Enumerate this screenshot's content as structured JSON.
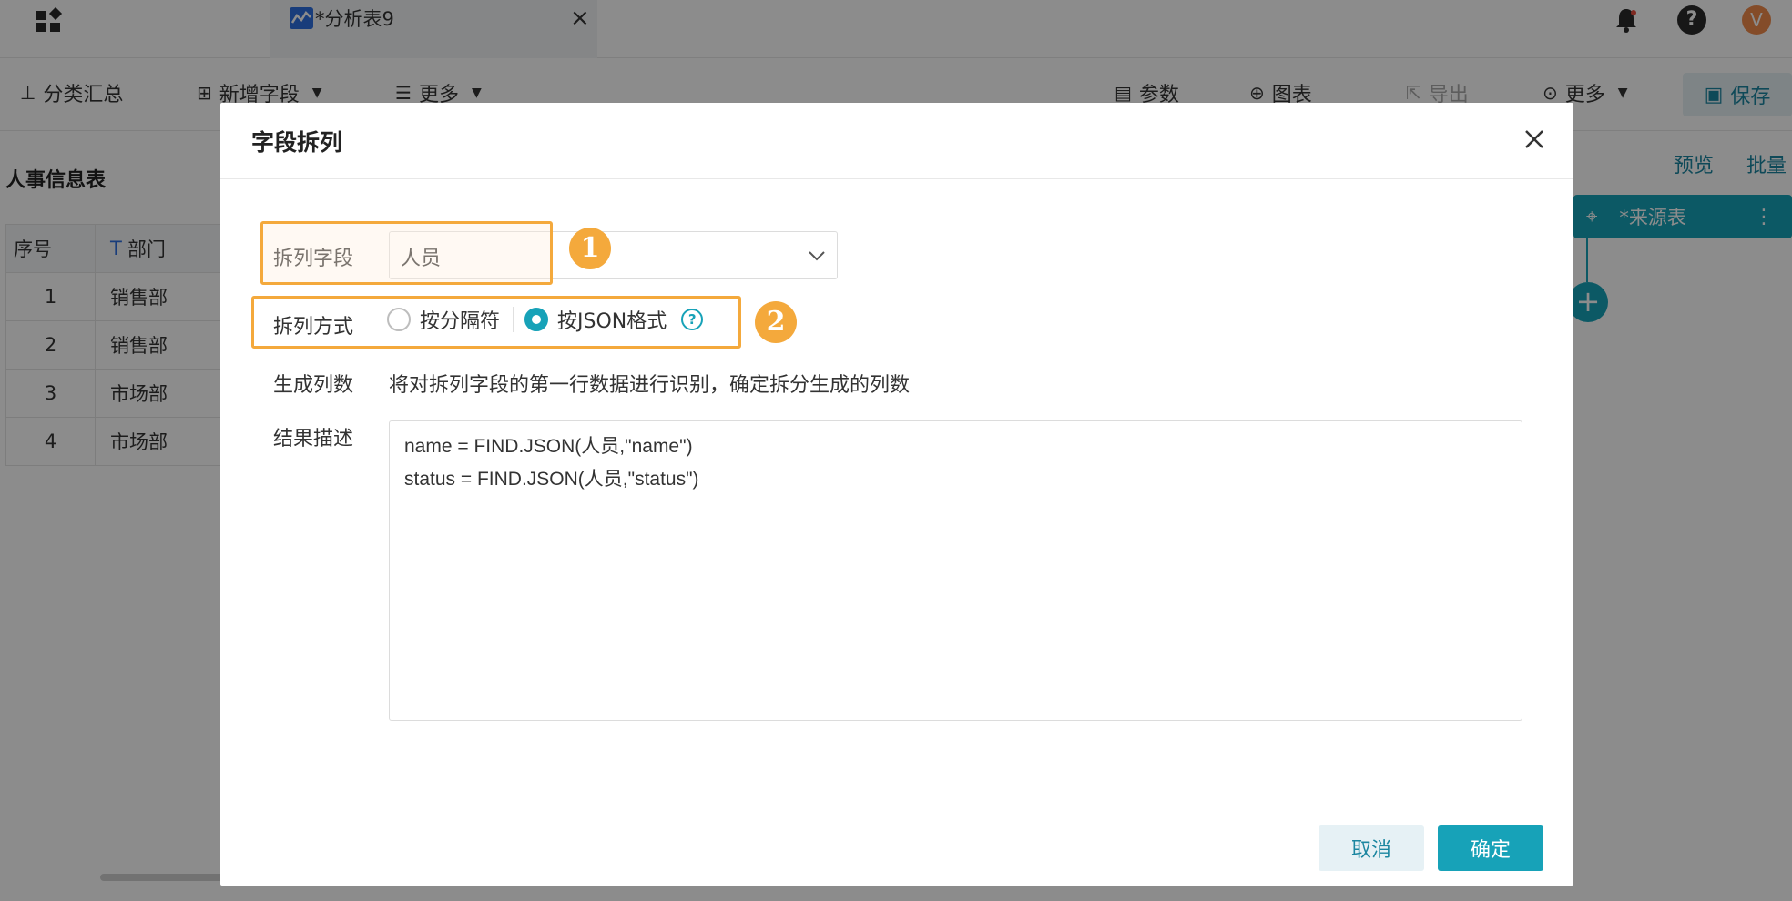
{
  "app": {
    "tab_title": "*分析表9",
    "tab_close": "×",
    "bell_icon": "bell-icon",
    "help_icon": "?",
    "avatar_initial": "V"
  },
  "toolbar": {
    "group_summary": "分类汇总",
    "add_field": "新增字段",
    "more_left": "更多",
    "params": "参数",
    "chart": "图表",
    "export": "导出",
    "more_right": "更多",
    "save": "保存"
  },
  "table": {
    "title": "人事信息表",
    "headers": [
      "序号",
      "部门"
    ],
    "rows": [
      [
        "1",
        "销售部"
      ],
      [
        "2",
        "销售部"
      ],
      [
        "3",
        "市场部"
      ],
      [
        "4",
        "市场部"
      ]
    ]
  },
  "right_panel": {
    "preview": "预览",
    "batch": "批量",
    "source_node": "*来源表",
    "add_node": "+"
  },
  "modal": {
    "title": "字段拆列",
    "split_field_label": "拆列字段",
    "split_field_value": "人员",
    "split_method_label": "拆列方式",
    "option_delimiter": "按分隔符",
    "option_json": "按JSON格式",
    "selected_option": "按JSON格式",
    "help_symbol": "?",
    "columns_label": "生成列数",
    "columns_desc": "将对拆列字段的第一行数据进行识别，确定拆分生成的列数",
    "result_label": "结果描述",
    "result_lines": [
      "name = FIND.JSON(人员,\"name\")",
      "status = FIND.JSON(人员,\"status\")"
    ],
    "cancel": "取消",
    "confirm": "确定",
    "badge_1": "1",
    "badge_2": "2"
  },
  "colors": {
    "accent": "#17a2b8",
    "highlight": "#f4a93c"
  }
}
